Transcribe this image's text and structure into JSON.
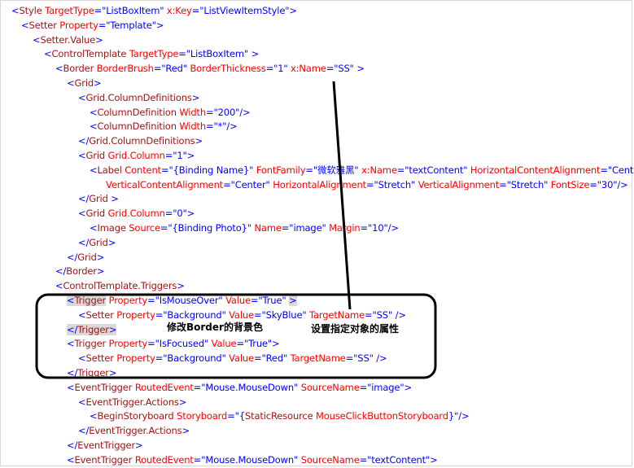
{
  "lines": [
    {
      "indent": 14,
      "segs": [
        {
          "c": "p",
          "t": "<"
        },
        {
          "c": "t",
          "t": "Style"
        },
        {
          "c": "a",
          "t": " TargetType"
        },
        {
          "c": "p",
          "t": "=\"ListBoxItem\""
        },
        {
          "c": "a",
          "t": " x:Key"
        },
        {
          "c": "p",
          "t": "=\"ListViewItemStyle\">"
        }
      ]
    },
    {
      "indent": 26,
      "segs": [
        {
          "c": "p",
          "t": "<"
        },
        {
          "c": "t",
          "t": "Setter"
        },
        {
          "c": "a",
          "t": " Property"
        },
        {
          "c": "p",
          "t": "=\"Template\">"
        }
      ]
    },
    {
      "indent": 40,
      "segs": [
        {
          "c": "p",
          "t": "<"
        },
        {
          "c": "t",
          "t": "Setter.Value"
        },
        {
          "c": "p",
          "t": ">"
        }
      ]
    },
    {
      "indent": 54,
      "segs": [
        {
          "c": "p",
          "t": "<"
        },
        {
          "c": "t",
          "t": "ControlTemplate"
        },
        {
          "c": "a",
          "t": " TargetType"
        },
        {
          "c": "p",
          "t": "=\"ListBoxItem\" >"
        }
      ]
    },
    {
      "indent": 68,
      "segs": [
        {
          "c": "p",
          "t": "<"
        },
        {
          "c": "t",
          "t": "Border"
        },
        {
          "c": "a",
          "t": " BorderBrush"
        },
        {
          "c": "p",
          "t": "=\"Red\""
        },
        {
          "c": "a",
          "t": " BorderThickness"
        },
        {
          "c": "p",
          "t": "=\"1\""
        },
        {
          "c": "a",
          "t": " x:Name"
        },
        {
          "c": "p",
          "t": "=\"SS\" >"
        }
      ]
    },
    {
      "indent": 82,
      "segs": [
        {
          "c": "p",
          "t": "<"
        },
        {
          "c": "t",
          "t": "Grid"
        },
        {
          "c": "p",
          "t": ">"
        }
      ]
    },
    {
      "indent": 96,
      "segs": [
        {
          "c": "p",
          "t": "<"
        },
        {
          "c": "t",
          "t": "Grid.ColumnDefinitions"
        },
        {
          "c": "p",
          "t": ">"
        }
      ]
    },
    {
      "indent": 110,
      "segs": [
        {
          "c": "p",
          "t": "<"
        },
        {
          "c": "t",
          "t": "ColumnDefinition"
        },
        {
          "c": "a",
          "t": " Width"
        },
        {
          "c": "p",
          "t": "=\"200\"/>"
        }
      ]
    },
    {
      "indent": 110,
      "segs": [
        {
          "c": "p",
          "t": "<"
        },
        {
          "c": "t",
          "t": "ColumnDefinition"
        },
        {
          "c": "a",
          "t": " Width"
        },
        {
          "c": "p",
          "t": "=\"*\"/>"
        }
      ]
    },
    {
      "indent": 96,
      "segs": [
        {
          "c": "p",
          "t": "</"
        },
        {
          "c": "t",
          "t": "Grid.ColumnDefinitions"
        },
        {
          "c": "p",
          "t": ">"
        }
      ]
    },
    {
      "indent": 96,
      "segs": [
        {
          "c": "p",
          "t": "<"
        },
        {
          "c": "t",
          "t": "Grid"
        },
        {
          "c": "a",
          "t": " Grid.Column"
        },
        {
          "c": "p",
          "t": "=\"1\">"
        }
      ]
    },
    {
      "indent": 110,
      "segs": [
        {
          "c": "p",
          "t": "<"
        },
        {
          "c": "t",
          "t": "Label"
        },
        {
          "c": "a",
          "t": " Content"
        },
        {
          "c": "p",
          "t": "=\"{Binding Name}\""
        },
        {
          "c": "a",
          "t": " FontFamily"
        },
        {
          "c": "p",
          "t": "=\"微软雅黑\""
        },
        {
          "c": "a",
          "t": " x:Name"
        },
        {
          "c": "p",
          "t": "=\"textContent\""
        },
        {
          "c": "a",
          "t": " HorizontalContentAlignment"
        },
        {
          "c": "p",
          "t": "=\"Center"
        }
      ]
    },
    {
      "indent": 130,
      "segs": [
        {
          "c": "a",
          "t": "VerticalContentAlignment"
        },
        {
          "c": "p",
          "t": "=\"Center\""
        },
        {
          "c": "a",
          "t": " HorizontalAlignment"
        },
        {
          "c": "p",
          "t": "=\"Stretch\""
        },
        {
          "c": "a",
          "t": "  VerticalAlignment"
        },
        {
          "c": "p",
          "t": "=\"Stretch\""
        },
        {
          "c": "a",
          "t": " FontSize"
        },
        {
          "c": "p",
          "t": "=\"30\"/>"
        }
      ]
    },
    {
      "indent": 96,
      "segs": [
        {
          "c": "p",
          "t": "</"
        },
        {
          "c": "t",
          "t": "Grid"
        },
        {
          "c": "p",
          "t": " >"
        }
      ]
    },
    {
      "indent": 96,
      "segs": [
        {
          "c": "p",
          "t": "<"
        },
        {
          "c": "t",
          "t": "Grid"
        },
        {
          "c": "a",
          "t": " Grid.Column"
        },
        {
          "c": "p",
          "t": "=\"0\">"
        }
      ]
    },
    {
      "indent": 110,
      "segs": [
        {
          "c": "p",
          "t": "<"
        },
        {
          "c": "t",
          "t": "Image"
        },
        {
          "c": "a",
          "t": " Source"
        },
        {
          "c": "p",
          "t": "=\"{Binding Photo}\""
        },
        {
          "c": "a",
          "t": " Name"
        },
        {
          "c": "p",
          "t": "=\"image\""
        },
        {
          "c": "a",
          "t": " Margin"
        },
        {
          "c": "p",
          "t": "=\"10\"/>"
        }
      ]
    },
    {
      "indent": 96,
      "segs": [
        {
          "c": "p",
          "t": "</"
        },
        {
          "c": "t",
          "t": "Grid"
        },
        {
          "c": "p",
          "t": ">"
        }
      ]
    },
    {
      "indent": 82,
      "segs": [
        {
          "c": "p",
          "t": "</"
        },
        {
          "c": "t",
          "t": "Grid"
        },
        {
          "c": "p",
          "t": ">"
        }
      ]
    },
    {
      "indent": 68,
      "segs": [
        {
          "c": "p",
          "t": "</"
        },
        {
          "c": "t",
          "t": "Border"
        },
        {
          "c": "p",
          "t": ">"
        }
      ]
    },
    {
      "indent": 68,
      "segs": [
        {
          "c": "p",
          "t": "<"
        },
        {
          "c": "t",
          "t": "ControlTemplate.Triggers"
        },
        {
          "c": "p",
          "t": ">"
        }
      ]
    },
    {
      "indent": 82,
      "segs": [
        {
          "c": "p hl",
          "t": "<"
        },
        {
          "c": "t hl",
          "t": "Trigger"
        },
        {
          "c": "a",
          "t": "  Property"
        },
        {
          "c": "p",
          "t": "=\"IsMouseOver\""
        },
        {
          "c": "a",
          "t": "   Value"
        },
        {
          "c": "p",
          "t": "=\"True\" "
        },
        {
          "c": "p hl",
          "t": ">"
        }
      ]
    },
    {
      "indent": 96,
      "segs": [
        {
          "c": "p",
          "t": "<"
        },
        {
          "c": "t",
          "t": "Setter"
        },
        {
          "c": "a",
          "t": " Property"
        },
        {
          "c": "p",
          "t": "=\"Background\""
        },
        {
          "c": "a",
          "t": " Value"
        },
        {
          "c": "p",
          "t": "=\"SkyBlue\""
        },
        {
          "c": "a",
          "t": " TargetName"
        },
        {
          "c": "p",
          "t": "=\"SS\" />"
        }
      ]
    },
    {
      "indent": 82,
      "segs": [
        {
          "c": "p hl",
          "t": "</"
        },
        {
          "c": "t hl",
          "t": "Trigger"
        },
        {
          "c": "p hl",
          "t": ">"
        }
      ]
    },
    {
      "indent": 82,
      "segs": [
        {
          "c": "p",
          "t": "<"
        },
        {
          "c": "t",
          "t": "Trigger"
        },
        {
          "c": "a",
          "t": "  Property"
        },
        {
          "c": "p",
          "t": "=\"IsFocused\""
        },
        {
          "c": "a",
          "t": "  Value"
        },
        {
          "c": "p",
          "t": "=\"True\">"
        }
      ]
    },
    {
      "indent": 96,
      "segs": [
        {
          "c": "p",
          "t": "<"
        },
        {
          "c": "t",
          "t": "Setter"
        },
        {
          "c": "a",
          "t": " Property"
        },
        {
          "c": "p",
          "t": "=\"Background\""
        },
        {
          "c": "a",
          "t": " Value"
        },
        {
          "c": "p",
          "t": "=\"Red\""
        },
        {
          "c": "a",
          "t": "  TargetName"
        },
        {
          "c": "p",
          "t": "=\"SS\" />"
        }
      ]
    },
    {
      "indent": 82,
      "segs": [
        {
          "c": "p",
          "t": "</"
        },
        {
          "c": "t",
          "t": "Trigger"
        },
        {
          "c": "p",
          "t": ">"
        }
      ]
    },
    {
      "indent": 82,
      "segs": [
        {
          "c": "p",
          "t": "<"
        },
        {
          "c": "t",
          "t": "EventTrigger"
        },
        {
          "c": "a",
          "t": " RoutedEvent"
        },
        {
          "c": "p",
          "t": "=\"Mouse.MouseDown\""
        },
        {
          "c": "a",
          "t": " SourceName"
        },
        {
          "c": "p",
          "t": "=\"image\">"
        }
      ]
    },
    {
      "indent": 96,
      "segs": [
        {
          "c": "p",
          "t": "<"
        },
        {
          "c": "t",
          "t": "EventTrigger.Actions"
        },
        {
          "c": "p",
          "t": ">"
        }
      ]
    },
    {
      "indent": 110,
      "segs": [
        {
          "c": "p",
          "t": "<"
        },
        {
          "c": "t",
          "t": "BeginStoryboard"
        },
        {
          "c": "a",
          "t": " Storyboard"
        },
        {
          "c": "p",
          "t": "=\"{"
        },
        {
          "c": "t",
          "t": "StaticResource"
        },
        {
          "c": "a",
          "t": " MouseClickButtonStoryboard"
        },
        {
          "c": "p",
          "t": "}\"/>"
        }
      ]
    },
    {
      "indent": 96,
      "segs": [
        {
          "c": "p",
          "t": "</"
        },
        {
          "c": "t",
          "t": "EventTrigger.Actions"
        },
        {
          "c": "p",
          "t": ">"
        }
      ]
    },
    {
      "indent": 82,
      "segs": [
        {
          "c": "p",
          "t": "</"
        },
        {
          "c": "t",
          "t": "EventTrigger"
        },
        {
          "c": "p",
          "t": ">"
        }
      ]
    },
    {
      "indent": 82,
      "segs": [
        {
          "c": "p",
          "t": "<"
        },
        {
          "c": "t",
          "t": "EventTrigger"
        },
        {
          "c": "a",
          "t": " RoutedEvent"
        },
        {
          "c": "p",
          "t": "=\"Mouse.MouseDown\""
        },
        {
          "c": "a",
          "t": " SourceName"
        },
        {
          "c": "p",
          "t": "=\"textContent\">"
        }
      ]
    }
  ],
  "annotations": {
    "border_bg_label": "修改Border的背景色",
    "target_prop_label": "设置指定对象的属性"
  },
  "colors": {
    "tag": "#a31515",
    "attribute": "#ff0000",
    "punctuation_value": "#0000ff",
    "highlight": "#d9d9d9",
    "annotation_stroke": "#000000"
  }
}
